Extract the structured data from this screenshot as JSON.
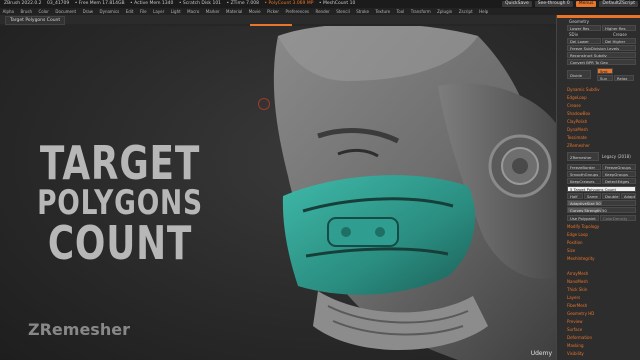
{
  "titlebar": {
    "app": "ZBrush 2022.0.2",
    "file": "03_41709",
    "free_mem": "• Free Mem 17.814GB",
    "active_mem": "• Active Mem 1340",
    "scratch": "• Scratch Disk 101",
    "ztime": "• ZTime 7.008",
    "polycount": "• PolyCount 3.069 MP",
    "meshcount": "• MeshCount 10",
    "quicksave": "QuickSave",
    "seethrough": "See-through 0",
    "menus": "Menus",
    "script": "DefaultZScript"
  },
  "menubar": [
    "Alpha",
    "Brush",
    "Color",
    "Document",
    "Draw",
    "Dynamics",
    "Edit",
    "File",
    "Layer",
    "Light",
    "Macro",
    "Marker",
    "Material",
    "Movie",
    "Picker",
    "Preferences",
    "Render",
    "Stencil",
    "Stroke",
    "Texture",
    "Tool",
    "Transform",
    "Zplugin",
    "Zscript",
    "Help"
  ],
  "tab": {
    "label": "Target Polygons Count"
  },
  "canvas": {
    "headline": [
      "TARGET",
      "POLYGONS",
      "COUNT"
    ],
    "watermark": "ZRemesher",
    "udemy": "Udemy"
  },
  "rightpanel": {
    "geometry_title": "Geometry",
    "lower_res": "Lower Res",
    "higher_res": "Higher Res",
    "sdiv": "SDiv",
    "crease": "Crease",
    "del_lower": "Del Lower",
    "del_higher": "Del Higher",
    "freeze_subdiv": "Freeze SubDivision Levels",
    "reconstruct": "Reconstruct Subdiv",
    "convert_bpr": "Convert BPR To Geo",
    "divide": "Divide",
    "smt": "Smt",
    "suv": "Suv",
    "relax": "Relax",
    "items_top": [
      "Dynamic Subdiv",
      "EdgeLoop",
      "Crease",
      "ShadowBox",
      "ClayPolish",
      "DynaMesh",
      "Tessimate"
    ],
    "zremesher_title": "ZRemesher",
    "zremesher_btn": "ZRemesher",
    "legacy": "Legacy (2018)",
    "freeze_border": "FreezeBorder",
    "freeze_groups": "FreezeGroups",
    "smooth_groups": "SmoothGroups",
    "keep_groups": "KeepGroups",
    "keep_creases": "KeepCreases",
    "detect_edges": "DetectEdges",
    "target_count": "5 Target Polygons Count",
    "half": "Half",
    "same": "Same",
    "double": "Double",
    "adapt": "Adapt",
    "adaptive_size": "AdaptiveSize 50",
    "curves_strength": "Curves Strength 50",
    "use_polypaint": "Use Polypaint",
    "color_density": "ColorDensity",
    "items_bottom": [
      "Modify Topology",
      "Edge Loop",
      "Position",
      "Size",
      "MeshIntegrity",
      "ArrayMesh",
      "NanoMesh",
      "Thick Skin",
      "Layers",
      "FiberMesh",
      "Geometry HD",
      "Preview",
      "Surface",
      "Deformation",
      "Masking",
      "Visibility"
    ],
    "sliders": {
      "target_count_level": 0.12,
      "adaptive_size_level": 0.5,
      "curves_strength_level": 0.5
    }
  }
}
